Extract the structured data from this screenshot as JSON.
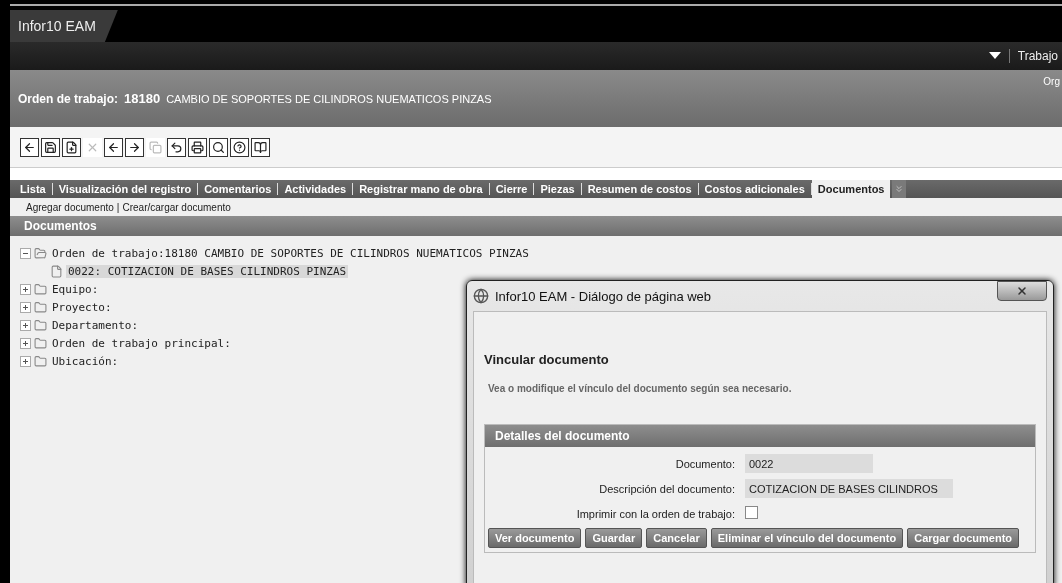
{
  "app_tab": {
    "title": "Infor10 EAM"
  },
  "nav": {
    "menu": "Trabajo"
  },
  "header": {
    "label": "Orden de trabajo:",
    "number": "18180",
    "description": "CAMBIO DE SOPORTES DE CILINDROS NUEMATICOS PINZAS",
    "org": "Org"
  },
  "toolbar": [
    {
      "kind": "back",
      "disabled": false
    },
    {
      "kind": "save",
      "disabled": false
    },
    {
      "kind": "new",
      "disabled": false
    },
    {
      "kind": "delete",
      "disabled": true
    },
    {
      "kind": "prev",
      "disabled": false
    },
    {
      "kind": "next",
      "disabled": false
    },
    {
      "kind": "copy",
      "disabled": true
    },
    {
      "kind": "undo",
      "disabled": false
    },
    {
      "kind": "print",
      "disabled": false
    },
    {
      "kind": "preview",
      "disabled": false
    },
    {
      "kind": "help",
      "disabled": false
    },
    {
      "kind": "book",
      "disabled": false
    }
  ],
  "tabs": [
    {
      "label": "Lista",
      "selected": false
    },
    {
      "label": "Visualización del registro",
      "selected": false
    },
    {
      "label": "Comentarios",
      "selected": false
    },
    {
      "label": "Actividades",
      "selected": false
    },
    {
      "label": "Registrar mano de obra",
      "selected": false
    },
    {
      "label": "Cierre",
      "selected": false
    },
    {
      "label": "Piezas",
      "selected": false
    },
    {
      "label": "Resumen de costos",
      "selected": false
    },
    {
      "label": "Costos adicionales",
      "selected": false
    },
    {
      "label": "Documentos",
      "selected": true
    }
  ],
  "actions": [
    "Agregar documento",
    "Crear/cargar documento"
  ],
  "actions_separator": "|",
  "section": {
    "title": "Documentos"
  },
  "tree": [
    {
      "label": "Orden de trabajo:18180 CAMBIO DE SOPORTES DE CILINDROS NUEMATICOS PINZAS",
      "expanded": true,
      "selected": false,
      "children": [
        {
          "label": "0022: COTIZACION DE BASES CILINDROS PINZAS",
          "selected": true
        }
      ]
    },
    {
      "label": "Equipo:",
      "expanded": false,
      "selected": false
    },
    {
      "label": "Proyecto:",
      "expanded": false,
      "selected": false
    },
    {
      "label": "Departamento:",
      "expanded": false,
      "selected": false
    },
    {
      "label": "Orden de trabajo principal:",
      "expanded": false,
      "selected": false
    },
    {
      "label": "Ubicación:",
      "expanded": false,
      "selected": false
    }
  ],
  "dialog": {
    "title": "Infor10 EAM - Diálogo de página web",
    "heading": "Vincular documento",
    "description": "Vea o modifique el vínculo del documento según sea necesario.",
    "panel_title": "Detalles del documento",
    "fields": [
      {
        "kind": "text",
        "label": "Documento:",
        "value": "0022"
      },
      {
        "kind": "text",
        "label": "Descripción del documento:",
        "value": "COTIZACION DE BASES CILINDROS"
      },
      {
        "kind": "checkbox",
        "label": "Imprimir con la orden de trabajo:",
        "checked": false
      }
    ],
    "buttons": [
      "Ver documento",
      "Guardar",
      "Cancelar",
      "Eliminar el vínculo del documento",
      "Cargar documento"
    ]
  }
}
